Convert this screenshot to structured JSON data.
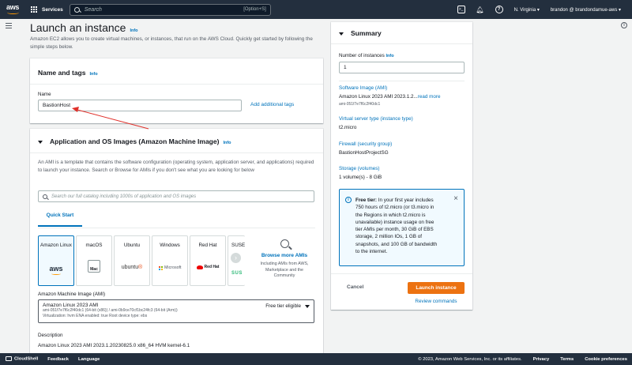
{
  "nav": {
    "logo": "aws",
    "services": "Services",
    "search_placeholder": "Search",
    "search_shortcut": "[Option+S]",
    "region": "N. Virginia ▾",
    "account": "brandon @ brandondamue-aws ▾"
  },
  "page": {
    "title": "Launch an instance",
    "title_info": "Info",
    "intro": "Amazon EC2 allows you to create virtual machines, or instances, that run on the AWS Cloud. Quickly get started by following the simple steps below."
  },
  "name_tags": {
    "heading": "Name and tags",
    "info": "Info",
    "name_label": "Name",
    "name_value": "BastionHost",
    "add_tags": "Add additional tags"
  },
  "ami": {
    "heading": "Application and OS Images (Amazon Machine Image)",
    "info": "Info",
    "description": "An AMI is a template that contains the software configuration (operating system, application server, and applications) required to launch your instance. Search or Browse for AMIs if you don't see what you are looking for below",
    "search_placeholder": "Search our full catalog including 1000s of application and OS images",
    "tab_quick_start": "Quick Start",
    "os": [
      {
        "name": "Amazon Linux",
        "logo": "aws"
      },
      {
        "name": "macOS",
        "logo": "Mac"
      },
      {
        "name": "Ubuntu",
        "logo": "ubuntu"
      },
      {
        "name": "Windows",
        "logo": "Microsoft"
      },
      {
        "name": "Red Hat",
        "logo": "Red Hat"
      },
      {
        "name": "SUSE Li",
        "logo": "SUS"
      }
    ],
    "browse_title": "Browse more AMIs",
    "browse_sub": "Including AMIs from AWS, Marketplace and the Community",
    "ami_label": "Amazon Machine Image (AMI)",
    "ami_name": "Amazon Linux 2023 AMI",
    "ami_ids": "ami-051f7e7f6c2f40dc1 (64-bit (x86)) / ami-0b9ce70cf1bc24fc3 (64-bit (Arm))",
    "ami_meta": "Virtualization: hvm    ENA enabled: true    Root device type: ebs",
    "ami_free": "Free tier eligible",
    "desc_label": "Description",
    "desc_value": "Amazon Linux 2023 AMI 2023.1.20230825.0 x86_64 HVM kernel-6.1"
  },
  "summary": {
    "heading": "Summary",
    "num_label": "Number of instances",
    "num_info": "Info",
    "num_value": "1",
    "image_label": "Software Image (AMI)",
    "image_value": "Amazon Linux 2023 AMI 2023.1.2...",
    "image_more": "read more",
    "image_id": "ami-051f7e7f6c2f40dc1",
    "type_label": "Virtual server type (instance type)",
    "type_value": "t2.micro",
    "fw_label": "Firewall (security group)",
    "fw_value": "BastionHostProjectSG",
    "storage_label": "Storage (volumes)",
    "storage_value": "1 volume(s) - 8 GiB",
    "free_tier_bold": "Free tier:",
    "free_tier_text": " In your first year includes 750 hours of t2.micro (or t3.micro in the Regions in which t2.micro is unavailable) instance usage on free tier AMIs per month, 30 GiB of EBS storage, 2 million IOs, 1 GB of snapshots, and 100 GB of bandwidth to the internet.",
    "cancel": "Cancel",
    "launch": "Launch instance",
    "review": "Review commands"
  },
  "footer": {
    "cloudshell": "CloudShell",
    "feedback": "Feedback",
    "language": "Language",
    "copyright": "© 2023, Amazon Web Services, Inc. or its affiliates.",
    "privacy": "Privacy",
    "terms": "Terms",
    "cookies": "Cookie preferences"
  },
  "colors": {
    "nav_bg": "#232f3e",
    "accent_orange": "#ec7211",
    "link_blue": "#0073bb",
    "annotation_red": "#e0302a"
  }
}
